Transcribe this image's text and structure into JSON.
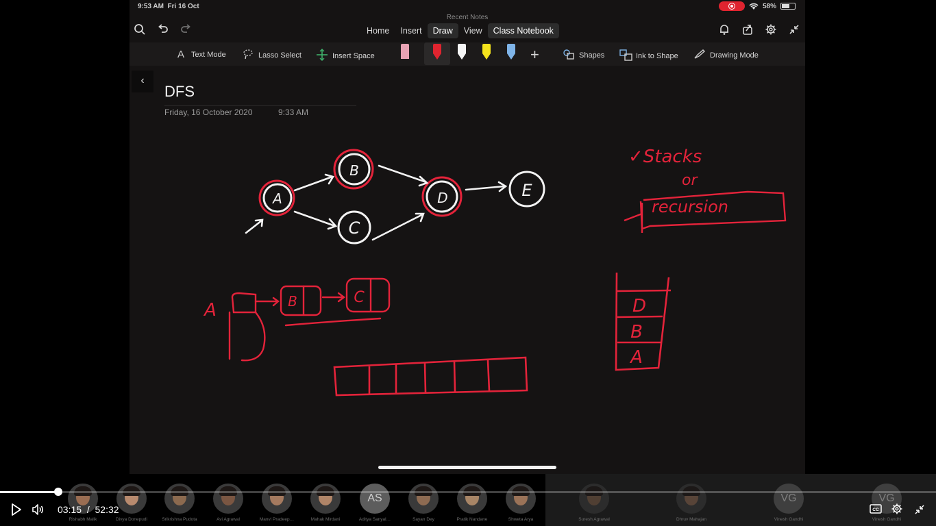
{
  "status_bar": {
    "time": "9:53 AM",
    "date": "Fri 16 Oct",
    "battery": "58%"
  },
  "app": {
    "recent_notes_label": "Recent Notes",
    "tabs": [
      {
        "label": "Home",
        "active": false
      },
      {
        "label": "Insert",
        "active": false
      },
      {
        "label": "Draw",
        "active": true
      },
      {
        "label": "View",
        "active": false
      },
      {
        "label": "Class Notebook",
        "active": false
      }
    ],
    "toolbar": {
      "text_mode": "Text Mode",
      "lasso_select": "Lasso Select",
      "insert_space": "Insert Space",
      "shapes": "Shapes",
      "ink_to_shape": "Ink to Shape",
      "drawing_mode": "Drawing Mode",
      "pens": [
        {
          "name": "eraser",
          "color": "#e8a3b4"
        },
        {
          "name": "red-pen",
          "color": "#e0242f"
        },
        {
          "name": "white-pen",
          "color": "#ffffff"
        },
        {
          "name": "yellow-highlighter",
          "color": "#f4e21c"
        },
        {
          "name": "blue-pen",
          "color": "#7fb4e8"
        }
      ]
    }
  },
  "page": {
    "title": "DFS",
    "date": "Friday, 16 October 2020",
    "time": "9:33 AM"
  },
  "ink": {
    "graph_nodes": [
      "A",
      "B",
      "C",
      "D",
      "E"
    ],
    "note_line_1": "✓Stacks",
    "note_line_2": "or",
    "note_line_3": "recursion",
    "list_head": "A",
    "list_node_1": "B",
    "list_node_2": "C",
    "stack_items": [
      "D",
      "B",
      "A"
    ],
    "colors": {
      "white_ink": "#f2f2f2",
      "red_ink": "#e3233a"
    }
  },
  "participants": [
    {
      "name": "Rishabh Malik",
      "initials": "",
      "dim": false
    },
    {
      "name": "Divya Donepudi",
      "initials": "",
      "dim": false
    },
    {
      "name": "Srikrishna Pudota",
      "initials": "",
      "dim": false
    },
    {
      "name": "Avi Agrawal",
      "initials": "",
      "dim": false
    },
    {
      "name": "Manvi Pradeep…",
      "initials": "",
      "dim": false
    },
    {
      "name": "Mahak Mirdani",
      "initials": "",
      "dim": false
    },
    {
      "name": "Aditya Sanyal…",
      "initials": "AS",
      "dim": false
    },
    {
      "name": "Sayan Dey",
      "initials": "",
      "dim": false
    },
    {
      "name": "Pratik Nandane",
      "initials": "",
      "dim": false
    },
    {
      "name": "Shweta Arya",
      "initials": "",
      "dim": false
    },
    {
      "name": "Suresh Agrawal",
      "initials": "",
      "dim": true
    },
    {
      "name": "Dhruv Mahajan",
      "initials": "",
      "dim": true
    },
    {
      "name": "Vinesh Gandhi",
      "initials": "VG",
      "dim": true
    },
    {
      "name": "Vinesh Gandhi",
      "initials": "VG",
      "dim": true
    }
  ],
  "player": {
    "current_time": "03:15",
    "separator": "/",
    "duration": "52:32",
    "progress_fraction": 0.062
  }
}
